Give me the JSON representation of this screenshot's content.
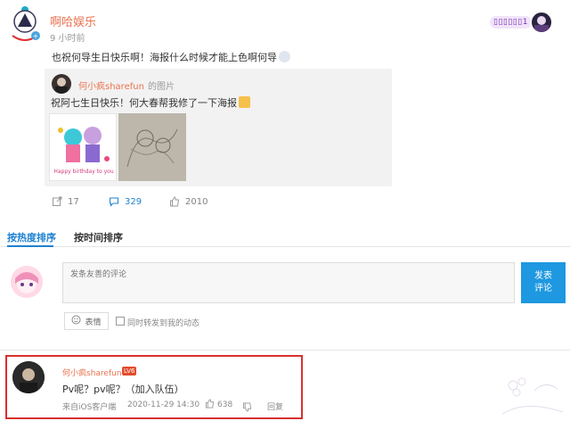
{
  "post": {
    "author": "啊哈娱乐",
    "time": "9 小时前",
    "badge": "▯▯▯▯▯▯1",
    "text": "也祝何导生日快乐啊！海报什么时候才能上色啊何导"
  },
  "quote": {
    "author": "何小疯sharefun",
    "tag": "的图片",
    "text": "祝阿七生日快乐！何大春帮我修了一下海报",
    "image1_caption": "Happy birthday to you"
  },
  "actions": {
    "repost": "17",
    "comments": "329",
    "likes": "2010"
  },
  "tabs": {
    "hot": "按热度排序",
    "time": "按时间排序"
  },
  "composer": {
    "placeholder": "发条友善的评论",
    "submit": "发表评论",
    "emoji": "表情",
    "share": "同时转发到我的动态"
  },
  "comment": {
    "author": "何小疯sharefun",
    "level": "LV6",
    "text": "Pv呢？pv呢？（加入队伍）",
    "source": "来自iOS客户端",
    "date": "2020-11-29 14:30",
    "likes": "638",
    "reply": "回复"
  },
  "colors": {
    "accent": "#1e82d2",
    "author": "#eb7350",
    "highlight_frame": "#d9302c",
    "submit": "#1e98e0"
  },
  "icons": [
    "repost-icon",
    "comment-icon",
    "thumb-up-icon",
    "thumb-down-icon",
    "emoji-icon"
  ]
}
